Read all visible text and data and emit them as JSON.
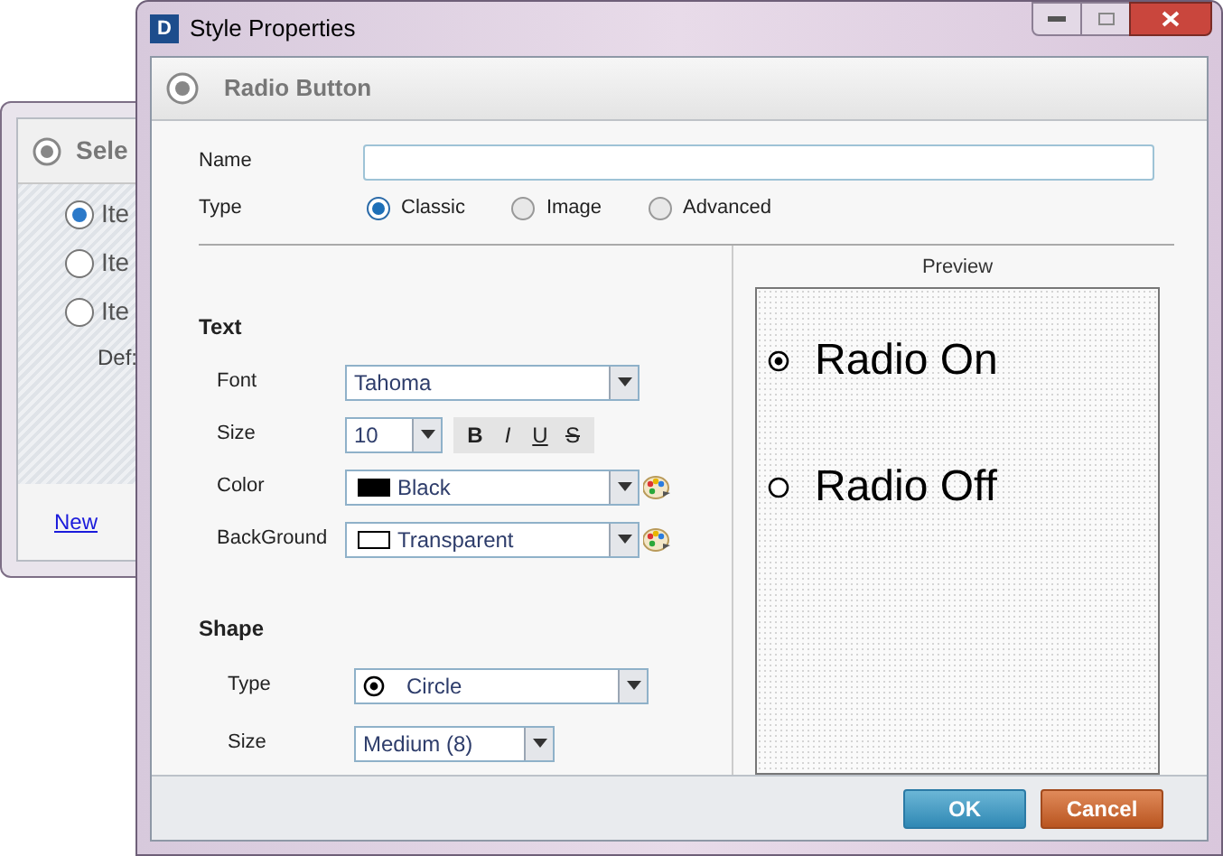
{
  "background_window": {
    "title": "Sele",
    "items": [
      {
        "label": "Ite",
        "selected": true
      },
      {
        "label": "Ite",
        "selected": false
      },
      {
        "label": "Ite",
        "selected": false
      }
    ],
    "default_label": "Def:",
    "new_link": "New"
  },
  "window": {
    "title": "Style Properties",
    "icon_letter": "D"
  },
  "header": {
    "title": "Radio Button"
  },
  "name_field": {
    "label": "Name"
  },
  "type_field": {
    "label": "Type",
    "options": [
      {
        "label": "Classic",
        "selected": true
      },
      {
        "label": "Image",
        "selected": false
      },
      {
        "label": "Advanced",
        "selected": false
      }
    ]
  },
  "text_section": {
    "title": "Text",
    "font": {
      "label": "Font",
      "value": "Tahoma"
    },
    "size": {
      "label": "Size",
      "value": "10"
    },
    "styles": [
      {
        "label": "B",
        "kind": "bold"
      },
      {
        "label": "I",
        "kind": "italic"
      },
      {
        "label": "U",
        "kind": "underline"
      },
      {
        "label": "S",
        "kind": "strike"
      }
    ],
    "colors": [
      {
        "label": "Color",
        "value": "Black",
        "kind": "solid"
      },
      {
        "label": "BackGround",
        "value": "Transparent",
        "kind": "outline"
      }
    ]
  },
  "shape_section": {
    "title": "Shape",
    "type": {
      "label": "Type",
      "value": "Circle"
    },
    "size": {
      "label": "Size",
      "value": "Medium (8)"
    }
  },
  "preview": {
    "title": "Preview",
    "items": [
      {
        "label": "Radio On",
        "selected": true
      },
      {
        "label": "Radio Off",
        "selected": false
      }
    ]
  },
  "buttons": [
    {
      "label": "OK",
      "kind": "primary"
    },
    {
      "label": "Cancel",
      "kind": "cancel"
    }
  ]
}
